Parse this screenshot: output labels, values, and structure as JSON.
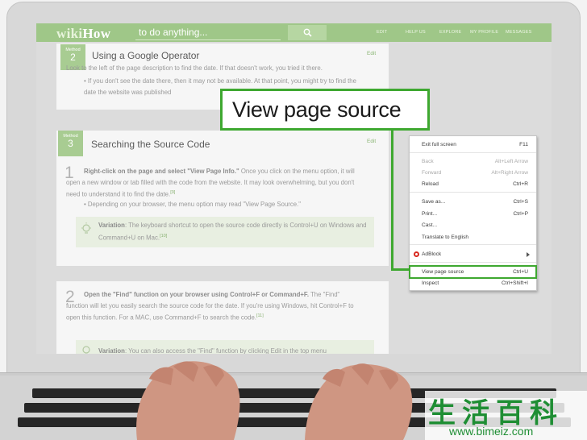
{
  "site": {
    "logo_wiki": "wiki",
    "logo_how": "How",
    "search_placeholder": "to do anything...",
    "nav": [
      "EDIT",
      "HELP US",
      "EXPLORE",
      "MY PROFILE",
      "MESSAGES"
    ]
  },
  "method2": {
    "badge_word": "Method",
    "badge_num": "2",
    "title": "Using a Google Operator",
    "edit": "Edit",
    "cut_line": "Look to the left of the page description to find the date. If that doesn't work, you tried it there.",
    "bullet": "If you don't see the date there, then it may not be available. At that point, you might try to find the date the website was published"
  },
  "method3": {
    "badge_word": "Method",
    "badge_num": "3",
    "title": "Searching the Source Code",
    "edit": "Edit",
    "step1": {
      "num": "1",
      "bold": "Right-click on the page and select \"View Page Info.\"",
      "text": " Once you click on the menu option, it will open a new window or tab filled with the code from the website. It may look overwhelming, but you don't need to understand it to find the date.",
      "ref": "[9]",
      "bullet": "Depending on your browser, the menu option may read \"View Page Source.\"",
      "tip_bold": "Variation",
      "tip_text": ": The keyboard shortcut to open the source code directly is Control+U on Windows and Command+U on Mac.",
      "tip_ref": "[10]"
    },
    "step2": {
      "num": "2",
      "bold": "Open the \"Find\" function on your browser using Control+F or Command+F.",
      "text": " The \"Find\" function will let you easily search the source code for the date. If you're using Windows, hit Control+F to open this function. For a MAC, use Command+F to search the code.",
      "ref": "[11]",
      "tip_bold": "Variation",
      "tip_text": ": You can also access the \"Find\" function by clicking Edit in the top menu"
    }
  },
  "context_menu": {
    "items": [
      {
        "label": "Exit full screen",
        "key": "F11",
        "disabled": false
      },
      {
        "label": "Back",
        "key": "Alt+Left Arrow",
        "disabled": true
      },
      {
        "label": "Forward",
        "key": "Alt+Right Arrow",
        "disabled": true
      },
      {
        "label": "Reload",
        "key": "Ctrl+R",
        "disabled": false
      },
      {
        "label": "Save as...",
        "key": "Ctrl+S",
        "disabled": false
      },
      {
        "label": "Print...",
        "key": "Ctrl+P",
        "disabled": false
      },
      {
        "label": "Cast...",
        "key": "",
        "disabled": false
      },
      {
        "label": "Translate to English",
        "key": "",
        "disabled": false
      },
      {
        "label": "AdBlock",
        "key": "",
        "disabled": false
      },
      {
        "label": "View page source",
        "key": "Ctrl+U",
        "disabled": false
      },
      {
        "label": "Inspect",
        "key": "Ctrl+Shift+I",
        "disabled": false
      }
    ]
  },
  "callout": "View page source",
  "watermark": {
    "chars": "生活百科",
    "url": "www.bimeiz.com"
  },
  "colors": {
    "site_green": "#9fc788",
    "highlight_green": "#3ea830",
    "watermark_green": "#1f8e34"
  }
}
